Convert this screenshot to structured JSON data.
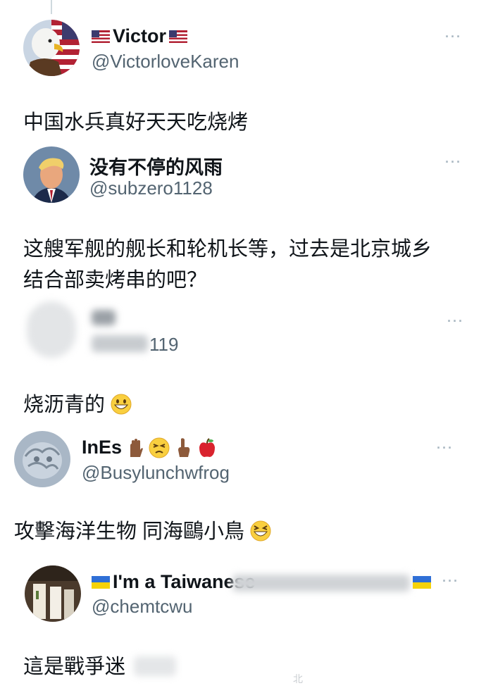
{
  "posts": [
    {
      "display_name": "Victor",
      "name_flags": [
        "us-flag-icon",
        "us-flag-icon"
      ],
      "handle": "@VictorloveKaren",
      "text_lines": [
        "中国水兵真好天天吃烧烤"
      ],
      "more": "···"
    },
    {
      "display_name": "没有不停的风雨",
      "handle": "@subzero1128",
      "text_lines": [
        "这艘军舰的舰长和轮机长等，过去是北京城乡",
        "结合部卖烤串的吧？"
      ],
      "more": "···"
    },
    {
      "display_name": "",
      "handle_visible": "119",
      "text_lines": [
        "烧沥青的"
      ],
      "text_emoji": "grinning-face-icon",
      "more": "···",
      "redacted": true
    },
    {
      "display_name": "InEs",
      "name_emojis": [
        "raised-hand-icon",
        "persevering-face-icon",
        "index-pointing-up-icon",
        "red-apple-icon"
      ],
      "handle": "@Busylunchwfrog",
      "text_lines": [
        "攻擊海洋生物 同海鷗小鳥"
      ],
      "text_emoji": "laughing-face-icon",
      "more": "···"
    },
    {
      "display_name": "I'm a Taiwanese",
      "name_flags": [
        "ukraine-flag-icon",
        "ukraine-flag-icon"
      ],
      "handle": "@chemtcwu",
      "text_lines": [
        "這是戰爭迷"
      ],
      "more": "···"
    }
  ],
  "watermark": "北",
  "colors": {
    "text": "#0f1419",
    "handle": "#536471",
    "more": "#aab8c2",
    "thread_line": "#cfd9de"
  }
}
